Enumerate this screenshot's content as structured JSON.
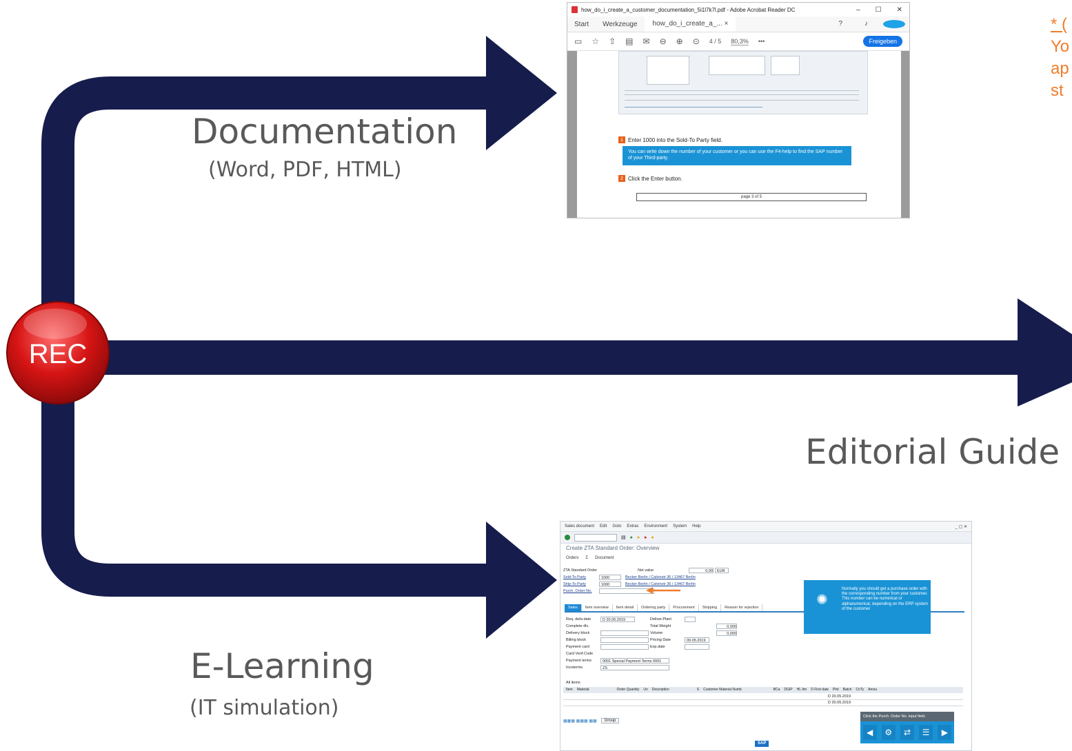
{
  "diagram": {
    "rec_label": "REC",
    "branches": [
      {
        "title": "Documentation",
        "subtitle": "(Word, PDF, HTML)"
      },
      {
        "title": "Editorial Guide",
        "subtitle": ""
      },
      {
        "title": "E-Learning",
        "subtitle": "(IT simulation)"
      }
    ],
    "note_lines": [
      "* (",
      "Yo",
      "ap",
      "st"
    ],
    "colors": {
      "arrow": "#161d4d",
      "rec": "#d61414",
      "note": "#f07c2b",
      "label": "#595959"
    }
  },
  "acrobat": {
    "window_title": "how_do_i_create_a_customer_documentation_5i1l7k7l.pdf - Adobe Acrobat Reader DC",
    "window_buttons": [
      "–",
      "☐",
      "✕"
    ],
    "tabs": [
      "Start",
      "Werkzeuge"
    ],
    "doc_tab": "how_do_i_create_a_... ×",
    "page_indicator": "4  / 5",
    "zoom": "80,3%",
    "share_button": "Freigeben",
    "step1_num": "1",
    "step1_text": "Enter 1000 into the Sold-To Party field.",
    "info_text": "You can write down the number of your customer or you can use the F4-help to find the SAP number of your Third-party.",
    "step2_num": "2",
    "step2_text": "Click the Enter button.",
    "page_footer": "page 3 of 5"
  },
  "sap": {
    "menu": [
      "Sales document",
      "Edit",
      "Goto",
      "Extras",
      "Environment",
      "System",
      "Help"
    ],
    "title": "Create ZTA Standard Order: Overview",
    "app_toolbar": [
      "Orders",
      "Σ",
      "Document"
    ],
    "fields": {
      "order_type": "ZTA Standard Order",
      "net_value_label": "Net value",
      "net_value": "0,00",
      "currency": "EUR",
      "sold_to_label": "Sold-To Party",
      "sold_to_value": "1000",
      "sold_to_desc": "Becker Berlin / Calvinstr 36 / 13467 Berlin",
      "ship_to_label": "Ship-To Party",
      "ship_to_value": "1000",
      "ship_to_desc": "Becker Berlin / Calvinstr 36 / 13467 Berlin",
      "po_label": "Purch. Order No."
    },
    "tabs": [
      "Sales",
      "Item overview",
      "Item detail",
      "Ordering party",
      "Procurement",
      "Shipping",
      "Reason for rejection"
    ],
    "sales_fields": [
      [
        "Req. deliv.date",
        "D  20.05.2019"
      ],
      [
        "Complete dlv.",
        ""
      ],
      [
        "Delivery block",
        ""
      ],
      [
        "Billing block",
        ""
      ],
      [
        "Payment card",
        ""
      ],
      [
        "Card Verif.Code",
        ""
      ],
      [
        "Payment terms",
        "0001  Special Payment Terms 0001"
      ],
      [
        "Incoterms",
        "ZS"
      ]
    ],
    "right_fields": [
      [
        "Deliver.Plant",
        ""
      ],
      [
        "Total Weight",
        "0,000"
      ],
      [
        "Volume",
        "0,000"
      ],
      [
        "Pricing Date",
        "09.05.2019"
      ],
      [
        "Exp.date",
        ""
      ]
    ],
    "items_label": "All items",
    "item_columns": [
      "Item",
      "Material",
      "Order Quantity",
      "Un",
      "Description",
      "S",
      "Customer Material Numb",
      "BCa",
      "DGIP",
      "HL Itm",
      "D First date",
      "Plnt",
      "Batch",
      "CnTy",
      "Amou"
    ],
    "item_dates": [
      "D 20.05.2019",
      "D 20.05.2019"
    ],
    "group_button": "Group",
    "hint_text": "Normally you should get a purchase order with the corresponding number from your customer. This number can be numerical or alphanumerical, depending on the ERP system of the customer",
    "nav_instruction": "Click the Purch. Order No. input field.",
    "nav_buttons": [
      "◀",
      "⚙",
      "⇄",
      "☰",
      "▶"
    ],
    "brand": "SAP"
  }
}
